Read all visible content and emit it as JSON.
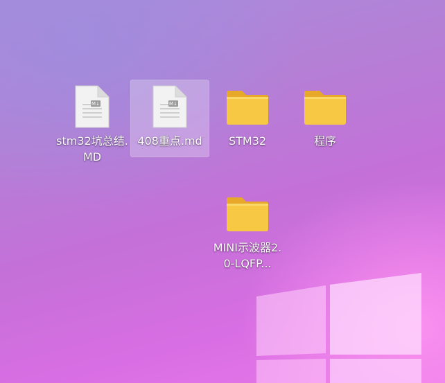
{
  "desktop": {
    "icons": [
      {
        "name": "stm32坑总结.MD",
        "type": "markdown-file-icon"
      },
      {
        "name": "408重点.md",
        "type": "markdown-file-icon",
        "selected": true
      },
      {
        "name": "STM32",
        "type": "folder-icon"
      },
      {
        "name": "程序",
        "type": "folder-icon"
      },
      {
        "name": "MINI示波器2.0-LQFP...",
        "type": "folder-icon"
      }
    ],
    "wallpaper": "windows-11-logo-wallpaper",
    "colors": {
      "folder": "#f7c844",
      "folder_back": "#e8a92a",
      "file": "#f2f2f2",
      "accent": "#d86ee3"
    }
  }
}
